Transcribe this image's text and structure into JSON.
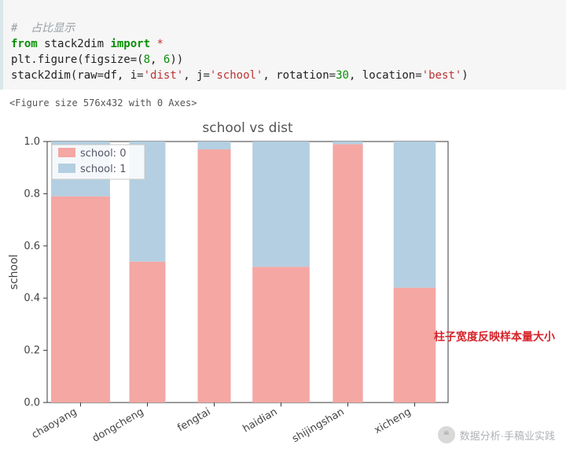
{
  "code": {
    "comment": "#  占比显示",
    "l1a": "from",
    "l1b": "stack2dim",
    "l1c": "import",
    "l1d": "*",
    "l2a": "plt.figure(figsize",
    "l2b": "=(",
    "l2c": "8",
    "l2d": ",",
    "l2e": "6",
    "l2f": "))",
    "l3a": "stack2dim(raw",
    "l3b": "=",
    "l3c": "df, i",
    "l3d": "=",
    "l3e": "'dist'",
    "l3f": ", j",
    "l3g": "=",
    "l3h": "'school'",
    "l3i": ", rotation",
    "l3j": "=",
    "l3k": "30",
    "l3l": ", location",
    "l3m": "=",
    "l3n": "'best'",
    "l3o": ")"
  },
  "repr_text": "<Figure size 576x432 with 0 Axes>",
  "annotation": "柱子宽度反映样本量大小",
  "watermark": "数据分析·手稿业实践",
  "chart_data": {
    "type": "bar",
    "title": "school vs dist",
    "ylabel": "school",
    "xlabel": "",
    "ylim": [
      0,
      1.0
    ],
    "yticks": [
      0.0,
      0.2,
      0.4,
      0.6,
      0.8,
      1.0
    ],
    "categories": [
      "chaoyang",
      "dongcheng",
      "fengtai",
      "haidian",
      "shijingshan",
      "xicheng"
    ],
    "bar_widths": [
      0.98,
      0.6,
      0.55,
      0.95,
      0.5,
      0.7
    ],
    "series": [
      {
        "name": "school: 0",
        "color": "#f4a7a3",
        "values": [
          0.79,
          0.54,
          0.97,
          0.52,
          0.99,
          0.44
        ]
      },
      {
        "name": "school: 1",
        "color": "#b4cfe1",
        "values": [
          0.21,
          0.46,
          0.03,
          0.48,
          0.01,
          0.56
        ]
      }
    ],
    "legend_position": "upper left"
  }
}
